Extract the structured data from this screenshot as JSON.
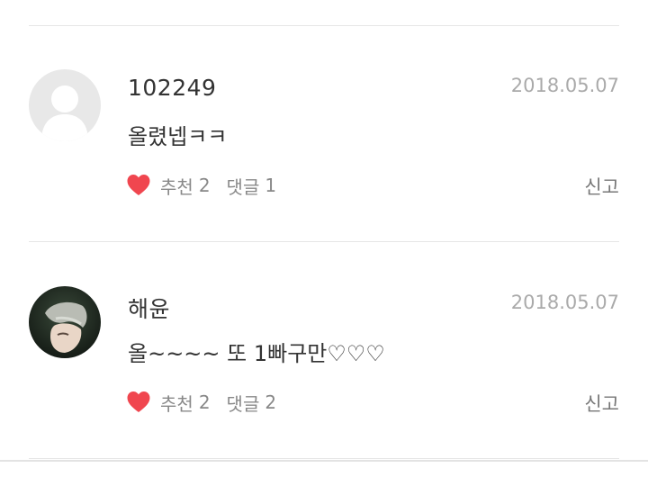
{
  "comments": [
    {
      "author": "102249",
      "date": "2018.05.07",
      "text": "올렸넵ㅋㅋ",
      "like_icon": "heart-icon",
      "recommend_label": "추천",
      "recommend_count": "2",
      "reply_label": "댓글",
      "reply_count": "1",
      "report_label": "신고",
      "avatar": "default-user-avatar"
    },
    {
      "author": "해윤",
      "date": "2018.05.07",
      "text": "올~~~~ 또 1빠구만♡♡♡",
      "like_icon": "heart-icon",
      "recommend_label": "추천",
      "recommend_count": "2",
      "reply_label": "댓글",
      "reply_count": "2",
      "report_label": "신고",
      "avatar": "profile-photo-avatar"
    }
  ],
  "colors": {
    "heart": "#f0464f",
    "date": "#aaaaaa",
    "muted": "#888888",
    "divider": "#e6e6e6"
  }
}
